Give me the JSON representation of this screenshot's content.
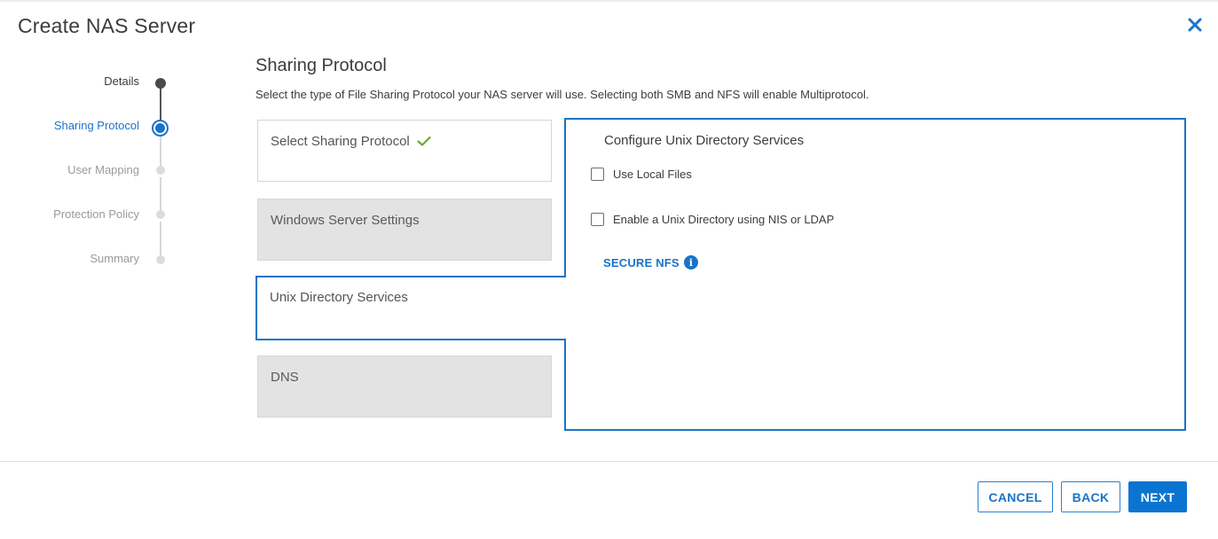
{
  "dialog": {
    "title": "Create NAS Server",
    "close_icon": "close-icon"
  },
  "stepper": {
    "steps": [
      {
        "label": "Details",
        "state": "done"
      },
      {
        "label": "Sharing Protocol",
        "state": "active"
      },
      {
        "label": "User Mapping",
        "state": "pending"
      },
      {
        "label": "Protection Policy",
        "state": "pending"
      },
      {
        "label": "Summary",
        "state": "pending"
      }
    ]
  },
  "section": {
    "title": "Sharing Protocol",
    "description": "Select the type of File Sharing Protocol your NAS server will use. Selecting both SMB and NFS will enable Multiprotocol."
  },
  "cards": [
    {
      "label": "Select Sharing Protocol",
      "state": "done",
      "icon": "checkmark-icon"
    },
    {
      "label": "Windows Server Settings",
      "state": "disabled"
    },
    {
      "label": "Unix Directory Services",
      "state": "active"
    },
    {
      "label": "DNS",
      "state": "disabled"
    }
  ],
  "panel": {
    "title": "Configure Unix Directory Services",
    "options": [
      {
        "label": "Use Local Files",
        "checked": false
      },
      {
        "label": "Enable a Unix Directory using NIS or LDAP",
        "checked": false
      }
    ],
    "secure_nfs_label": "SECURE NFS",
    "info_icon_glyph": "i"
  },
  "footer": {
    "cancel_label": "CANCEL",
    "back_label": "BACK",
    "next_label": "NEXT"
  },
  "colors": {
    "accent": "#1a73c8",
    "check": "#6aab2e",
    "disabled_card": "#e3e3e3"
  }
}
